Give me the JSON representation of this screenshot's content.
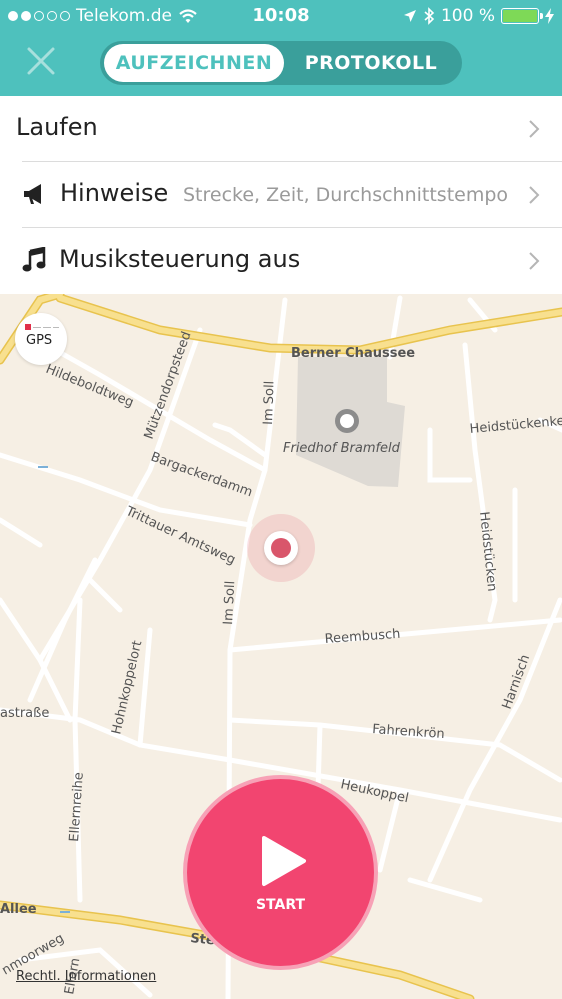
{
  "status_bar": {
    "carrier": "Telekom.de",
    "time": "10:08",
    "battery": "100 %",
    "battery_level": 1.0,
    "signal_bars_filled": 2,
    "signal_bars_total": 5,
    "icons": [
      "wifi-icon",
      "location-arrow-icon",
      "bluetooth-icon",
      "battery-icon",
      "charging-icon"
    ]
  },
  "header": {
    "close_icon": "close-icon",
    "tabs": [
      {
        "label": "AUFZEICHNEN",
        "active": true
      },
      {
        "label": "PROTOKOLL",
        "active": false
      }
    ]
  },
  "settings": [
    {
      "label": "Laufen",
      "icon": null
    },
    {
      "label": "Hinweise",
      "icon": "megaphone-icon",
      "detail": "Strecke, Zeit, Durchschnittstempo"
    },
    {
      "label": "Musiksteuerung aus",
      "icon": "music-note-icon"
    }
  ],
  "map": {
    "gps_label": "GPS",
    "poi": "Friedhof Bramfeld",
    "streets": [
      "Berner Chaussee",
      "Hildeboldtweg",
      "Mützendorpsteed",
      "Im Soll",
      "Heidstückenke",
      "Bargackerdamm",
      "Trittauer Amtsweg",
      "Heidstücken",
      "Reembusch",
      "Im Soll",
      "Hohnkoppelort",
      "Harnisch",
      "astraße",
      "Fahrenkrön",
      "Ellernreihe",
      "Heukoppel",
      "Allee",
      "Ste",
      "nmoorweg",
      "Ellern"
    ],
    "legal_link": "Rechtl. Informationen"
  },
  "start_button": {
    "label": "START",
    "icon": "play-icon"
  },
  "colors": {
    "header": "#4ec1bd",
    "segment_bg": "#3a9f9b",
    "start": "#f24570",
    "location": "#d9566b",
    "map_bg": "#f6efe4",
    "road_major": "#f3d77a"
  }
}
